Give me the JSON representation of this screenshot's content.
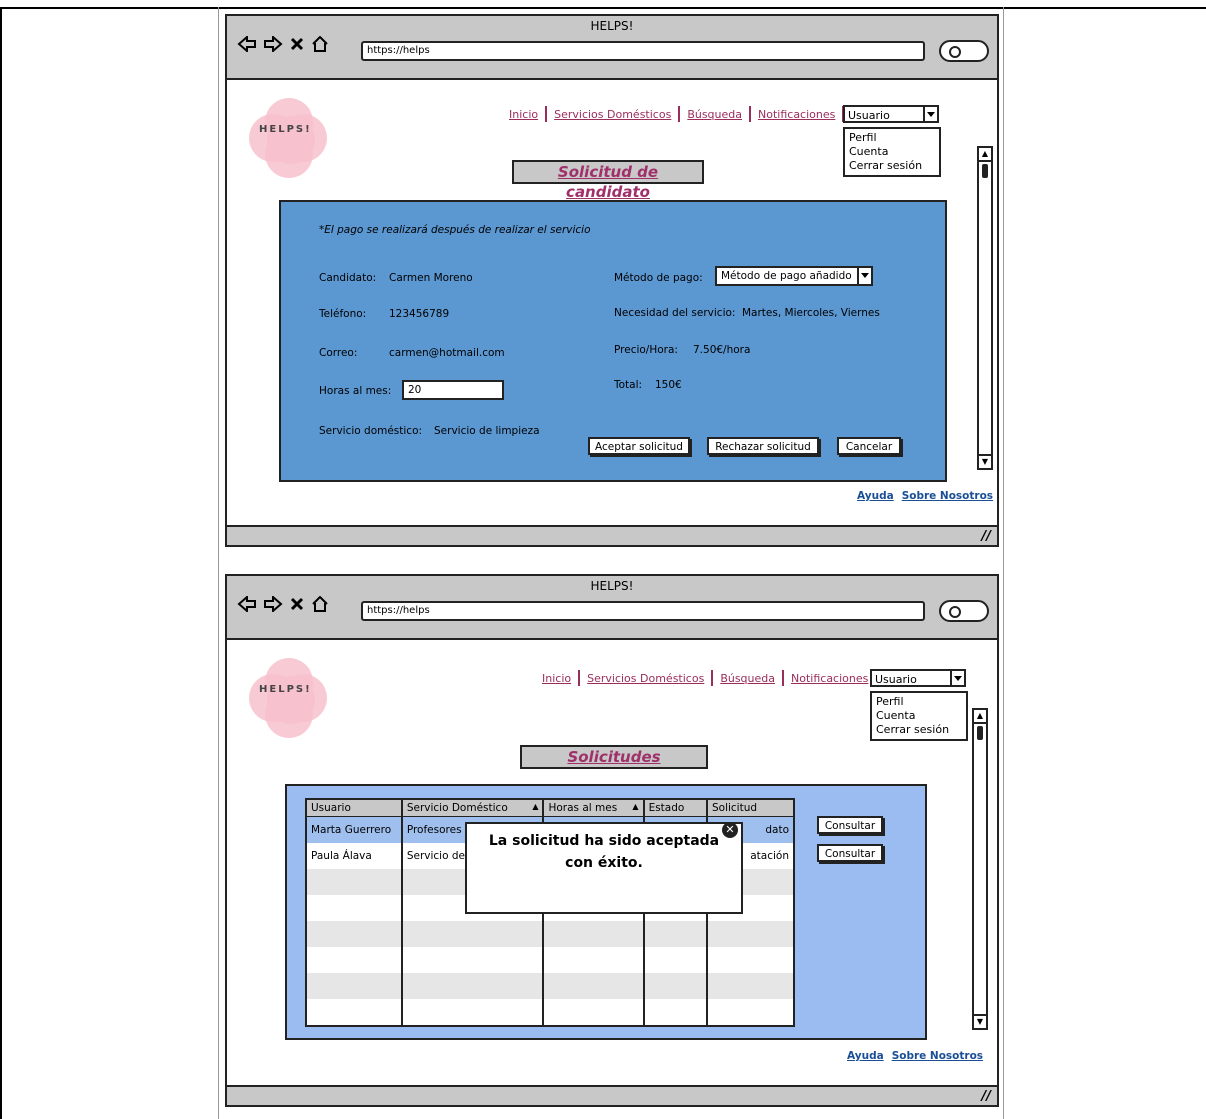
{
  "browser": {
    "title": "HELPS!",
    "url": "https://helps"
  },
  "logo": {
    "text": "HELPS!"
  },
  "nav": {
    "items": [
      "Inicio",
      "Servicios Domésticos",
      "Búsqueda",
      "Notificaciones"
    ],
    "user_select": "Usuario",
    "user_menu": [
      "Perfil",
      "Cuenta",
      "Cerrar sesión"
    ]
  },
  "footer": {
    "help": "Ayuda",
    "about": "Sobre Nosotros"
  },
  "screen1": {
    "page_title": "Solicitud de candidato",
    "note": "*El pago se realizará después de realizar el servicio",
    "candidate_label": "Candidato:",
    "candidate_value": "Carmen Moreno",
    "phone_label": "Teléfono:",
    "phone_value": "123456789",
    "email_label": "Correo:",
    "email_value": "carmen@hotmail.com",
    "hours_label": "Horas al mes:",
    "hours_value": "20",
    "service_label": "Servicio doméstico:",
    "service_value": "Servicio de limpieza",
    "payment_label": "Método de pago:",
    "payment_value": "Método de pago añadido",
    "need_label": "Necesidad del servicio:",
    "need_value": "Martes, Miercoles, Viernes",
    "price_label": "Precio/Hora:",
    "price_value": "7.50€/hora",
    "total_label": "Total:",
    "total_value": "150€",
    "accept_button": "Aceptar solicitud",
    "reject_button": "Rechazar solicitud",
    "cancel_button": "Cancelar"
  },
  "screen2": {
    "page_title": "Solicitudes",
    "columns": [
      "Usuario",
      "Servicio Doméstico",
      "Horas al mes",
      "Estado",
      "Solicitud"
    ],
    "rows": [
      [
        "Marta Guerrero",
        "Profesores",
        "",
        "",
        "dato"
      ],
      [
        "Paula Álava",
        "Servicio de",
        "",
        "",
        "atación"
      ]
    ],
    "consult_button": "Consultar",
    "popup_message": "La solicitud ha sido aceptada con éxito."
  },
  "colors": {
    "panel1": "#5b97d1",
    "panel2": "#9bbcf0",
    "nav_link": "#9b2d5a",
    "footer_link": "#1a4f96"
  }
}
